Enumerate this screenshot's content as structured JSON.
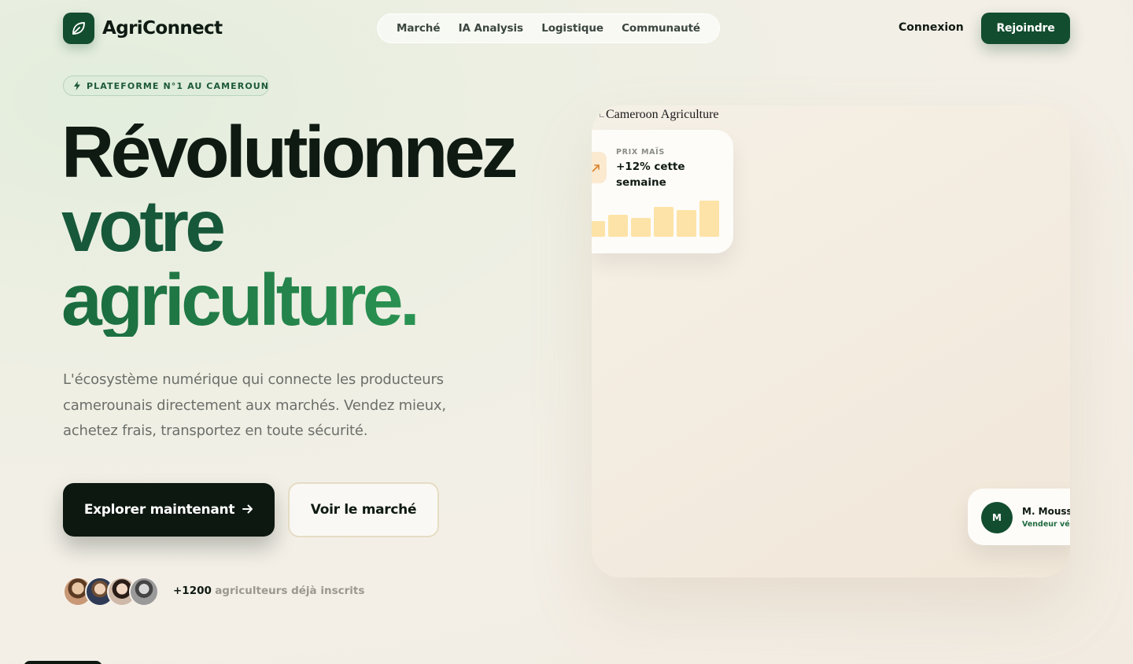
{
  "brand": {
    "name": "AgriConnect",
    "icon": "leaf-icon",
    "color": "#134d2f"
  },
  "nav": {
    "links": [
      "Marché",
      "IA Analysis",
      "Logistique",
      "Communauté"
    ],
    "login": "Connexion",
    "join": "Rejoindre"
  },
  "hero": {
    "badge": "PLATEFORME N°1 AU CAMEROUN",
    "headline": [
      "Révolutionnez",
      "votre",
      "agriculture."
    ],
    "subtitle": "L'écosystème numérique qui connecte les producteurs camerounais directement aux marchés. Vendez mieux, achetez frais, transportez en toute sécurité.",
    "cta_primary": "Explorer maintenant",
    "cta_secondary": "Voir le marché",
    "members_count": "+1200",
    "members_label": "agriculteurs déjà inscrits"
  },
  "visual": {
    "image_alt": "Cameroon Agriculture",
    "price_card": {
      "label": "PRIX MAÏS",
      "value": "+12% cette semaine",
      "icon": "trend-up-icon",
      "bar_color": "#fde3a7",
      "bars": [
        0.4,
        0.55,
        0.48,
        0.76,
        0.68,
        0.92
      ]
    },
    "seller_card": {
      "initial": "M",
      "name": "M. Moussa",
      "role": "Vendeur vérifié"
    }
  },
  "colors": {
    "accent": "#134d2f",
    "dark": "#0d1811",
    "green_light": "#2f9e58"
  }
}
